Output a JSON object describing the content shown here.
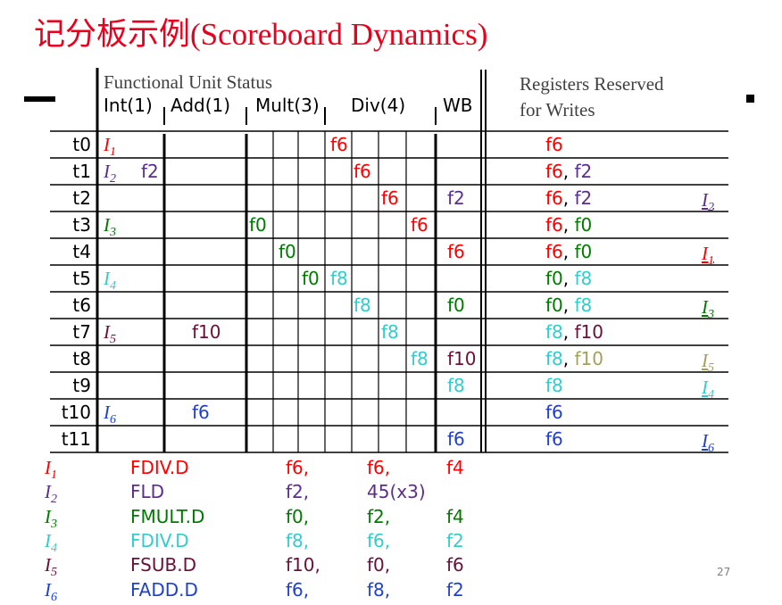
{
  "title": "记分板示例(Scoreboard Dynamics)",
  "header": {
    "functional_unit_status": "Functional Unit Status",
    "units": [
      "Int(1)",
      "Add(1)",
      "Mult(3)",
      "Div(4)",
      "WB"
    ],
    "registers_line1": "Registers Reserved",
    "registers_line2": "for Writes"
  },
  "colors": {
    "title": "#e8001c",
    "I1": "#ff0000",
    "I2": "#5b2d8e",
    "I3": "#007a00",
    "I4": "#33cccc",
    "I5": "#6b0f3a",
    "I6": "#1f3fd0",
    "I5_done": "#a3a05a"
  },
  "timeline": {
    "rows": [
      {
        "t": "t0",
        "int": {
          "i": "I",
          "s": "1",
          "c": "I1"
        },
        "cells": [
          {
            "col": "div1",
            "text": "f6",
            "c": "I1"
          }
        ],
        "regs": [
          {
            "text": "f6",
            "c": "I1"
          }
        ]
      },
      {
        "t": "t1",
        "int": {
          "i": "I",
          "s": "2",
          "c": "I2"
        },
        "int_dest": {
          "text": "f2",
          "c": "I2"
        },
        "cells": [
          {
            "col": "div2",
            "text": "f6",
            "c": "I1"
          }
        ],
        "regs": [
          {
            "text": "f6",
            "c": "I1"
          },
          {
            "text": "f2",
            "c": "I2"
          }
        ]
      },
      {
        "t": "t2",
        "cells": [
          {
            "col": "div3",
            "text": "f6",
            "c": "I1"
          },
          {
            "col": "wb",
            "text": "f2",
            "c": "I2"
          }
        ],
        "regs": [
          {
            "text": "f6",
            "c": "I1"
          },
          {
            "text": "f2",
            "c": "I2"
          }
        ],
        "done": {
          "i": "I",
          "s": "2",
          "c": "I2"
        }
      },
      {
        "t": "t3",
        "int": {
          "i": "I",
          "s": "3",
          "c": "I3"
        },
        "cells": [
          {
            "col": "mult1",
            "text": "f0",
            "c": "I3"
          },
          {
            "col": "div4",
            "text": "f6",
            "c": "I1"
          }
        ],
        "regs": [
          {
            "text": "f6",
            "c": "I1"
          },
          {
            "text": "f0",
            "c": "I3"
          }
        ]
      },
      {
        "t": "t4",
        "cells": [
          {
            "col": "mult2",
            "text": "f0",
            "c": "I3"
          },
          {
            "col": "wb",
            "text": "f6",
            "c": "I1"
          }
        ],
        "regs": [
          {
            "text": "f6",
            "c": "I1"
          },
          {
            "text": "f0",
            "c": "I3"
          }
        ],
        "done": {
          "i": "I",
          "s": "1",
          "c": "I1"
        }
      },
      {
        "t": "t5",
        "int": {
          "i": "I",
          "s": "4",
          "c": "I4"
        },
        "cells": [
          {
            "col": "mult3",
            "text": "f0",
            "c": "I3"
          },
          {
            "col": "div1",
            "text": "f8",
            "c": "I4"
          }
        ],
        "regs": [
          {
            "text": "f0",
            "c": "I3"
          },
          {
            "text": "f8",
            "c": "I4"
          }
        ]
      },
      {
        "t": "t6",
        "cells": [
          {
            "col": "div2",
            "text": "f8",
            "c": "I4"
          },
          {
            "col": "wb",
            "text": "f0",
            "c": "I3"
          }
        ],
        "regs": [
          {
            "text": "f0",
            "c": "I3"
          },
          {
            "text": "f8",
            "c": "I4"
          }
        ],
        "done": {
          "i": "I",
          "s": "3",
          "c": "I3"
        }
      },
      {
        "t": "t7",
        "int": {
          "i": "I",
          "s": "5",
          "c": "I5"
        },
        "cells": [
          {
            "col": "add",
            "text": "f10",
            "c": "I5"
          },
          {
            "col": "div3",
            "text": "f8",
            "c": "I4"
          }
        ],
        "regs": [
          {
            "text": "f8",
            "c": "I4"
          },
          {
            "text": "f10",
            "c": "I5"
          }
        ]
      },
      {
        "t": "t8",
        "cells": [
          {
            "col": "div4",
            "text": "f8",
            "c": "I4"
          },
          {
            "col": "wb",
            "text": "f10",
            "c": "I5"
          }
        ],
        "regs": [
          {
            "text": "f8",
            "c": "I4"
          },
          {
            "text": "f10",
            "c": "I5_done"
          }
        ],
        "done": {
          "i": "I",
          "s": "5",
          "c": "I5_done"
        }
      },
      {
        "t": "t9",
        "cells": [
          {
            "col": "wb",
            "text": "f8",
            "c": "I4"
          }
        ],
        "regs": [
          {
            "text": "f8",
            "c": "I4"
          }
        ],
        "done": {
          "i": "I",
          "s": "4",
          "c": "I4"
        }
      },
      {
        "t": "t10",
        "int": {
          "i": "I",
          "s": "6",
          "c": "I6"
        },
        "cells": [
          {
            "col": "add",
            "text": "f6",
            "c": "I6"
          }
        ],
        "regs": [
          {
            "text": "f6",
            "c": "I6"
          }
        ]
      },
      {
        "t": "t11",
        "cells": [
          {
            "col": "wb",
            "text": "f6",
            "c": "I6"
          }
        ],
        "regs": [
          {
            "text": "f6",
            "c": "I6"
          }
        ],
        "done": {
          "i": "I",
          "s": "6",
          "c": "I6"
        }
      }
    ]
  },
  "program": [
    {
      "i": "I",
      "s": "1",
      "c": "I1",
      "op": "FDIV.D",
      "a": "f6,",
      "b": "f6,",
      "d": "f4"
    },
    {
      "i": "I",
      "s": "2",
      "c": "I2",
      "op": "FLD",
      "a": "f2,",
      "b": "45(x3)",
      "d": ""
    },
    {
      "i": "I",
      "s": "3",
      "c": "I3",
      "op": "FMULT.D",
      "a": "f0,",
      "b": "f2,",
      "d": "f4"
    },
    {
      "i": "I",
      "s": "4",
      "c": "I4",
      "op": "FDIV.D",
      "a": "f8,",
      "b": "f6,",
      "d": "f2"
    },
    {
      "i": "I",
      "s": "5",
      "c": "I5",
      "op": "FSUB.D",
      "a": "f10,",
      "b": "f0,",
      "d": "f6"
    },
    {
      "i": "I",
      "s": "6",
      "c": "I6",
      "op": "FADD.D",
      "a": "f6,",
      "b": "f8,",
      "d": "f2"
    }
  ],
  "page_number": "27"
}
